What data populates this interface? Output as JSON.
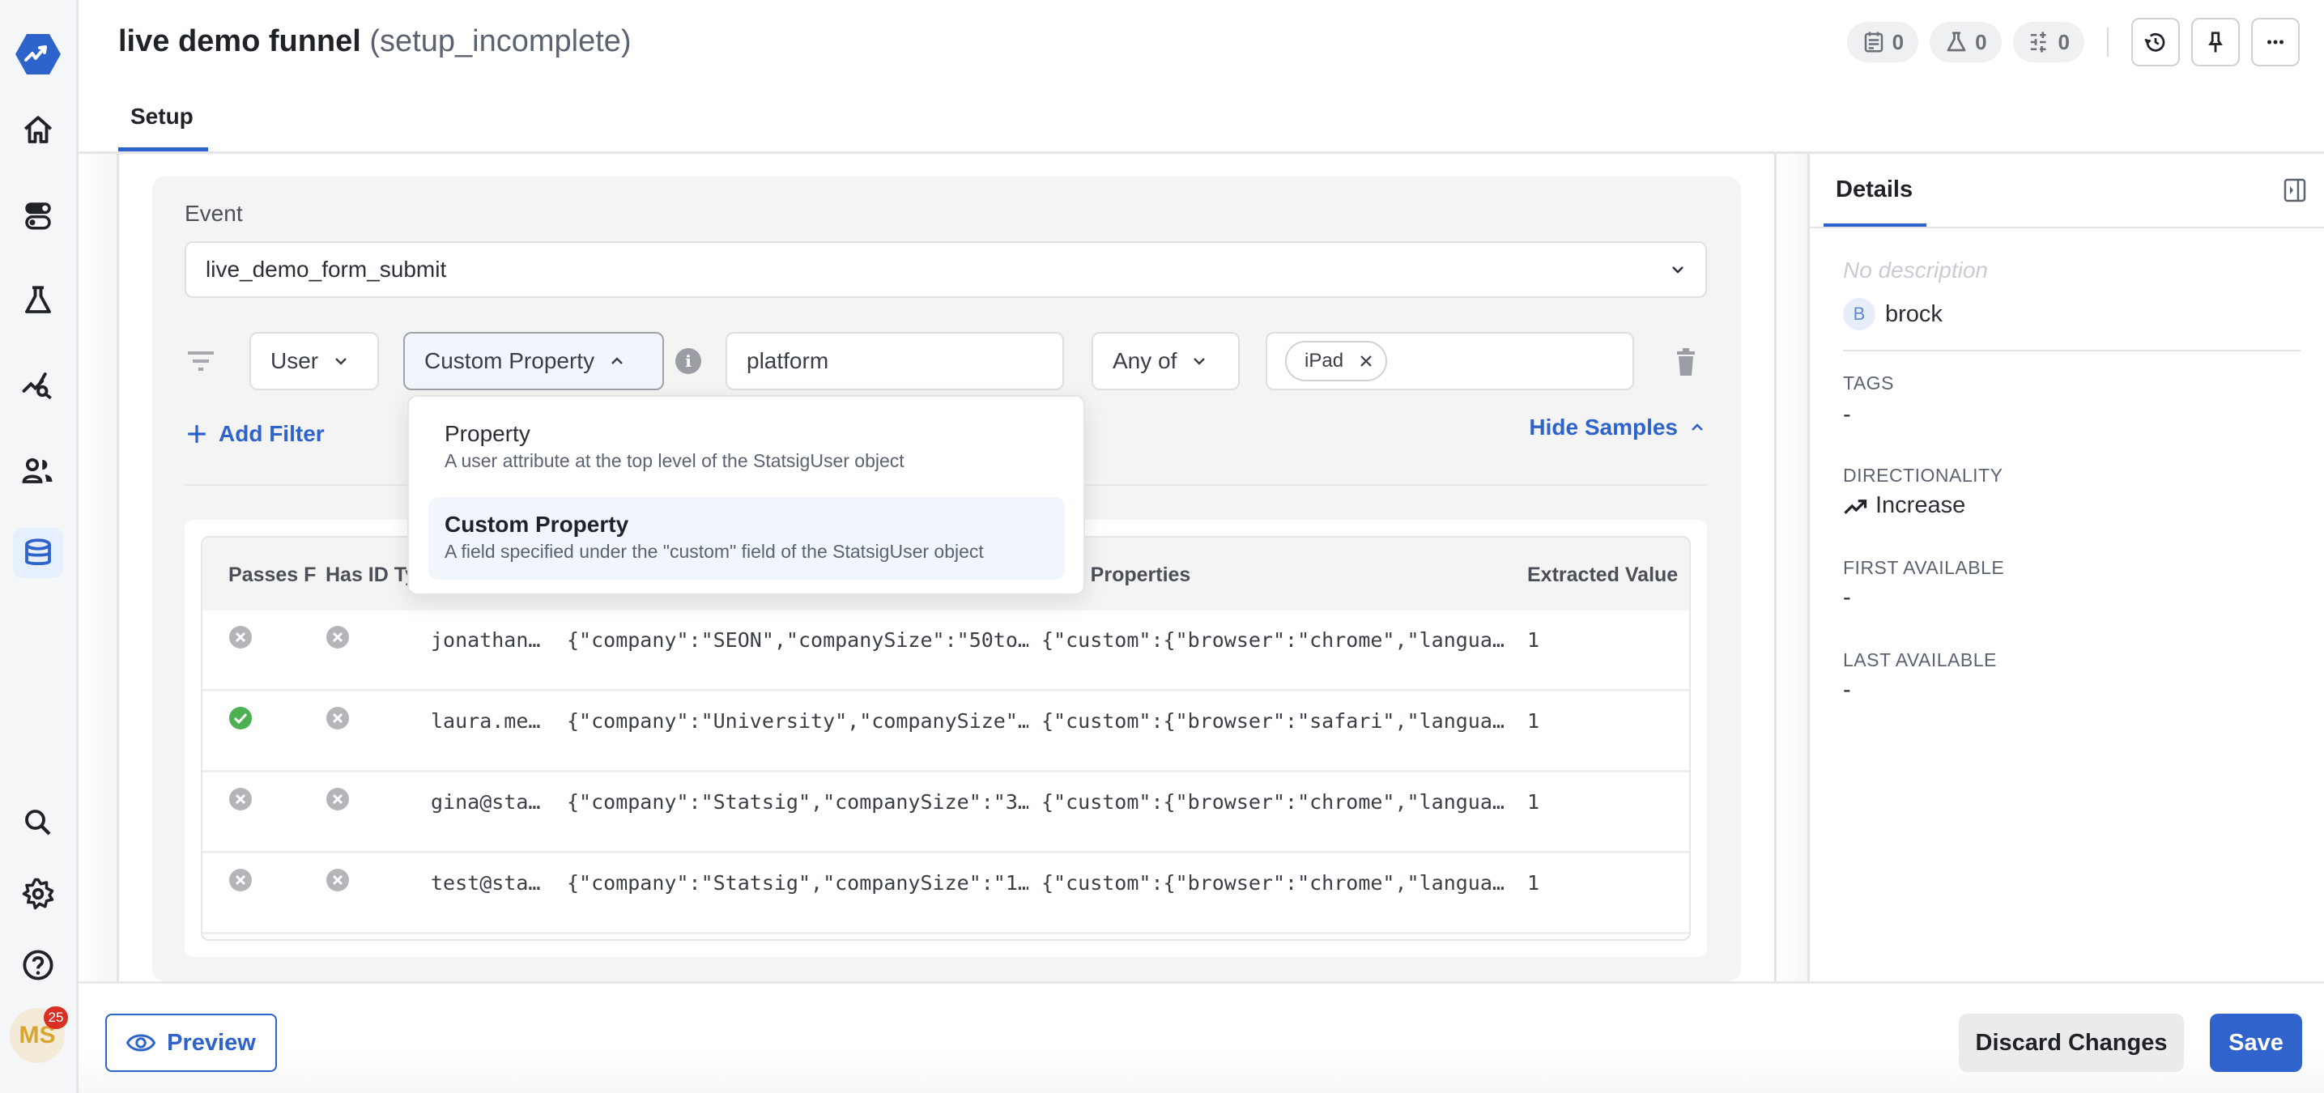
{
  "header": {
    "title": "live demo funnel",
    "status": "(setup_incomplete)",
    "tabs": [
      {
        "label": "Setup",
        "active": true
      }
    ],
    "badges": [
      {
        "icon": "report-icon",
        "count": "0"
      },
      {
        "icon": "experiment-icon",
        "count": "0"
      },
      {
        "icon": "sliders-icon",
        "count": "0"
      }
    ],
    "actions": [
      "history-icon",
      "pin-icon",
      "more-icon"
    ]
  },
  "sidebar": {
    "items": [
      {
        "icon": "home-icon",
        "label": "Home"
      },
      {
        "icon": "toggle-icon",
        "label": "Feature Gates"
      },
      {
        "icon": "flask-icon",
        "label": "Experiments"
      },
      {
        "icon": "analytics-icon",
        "label": "Analytics"
      },
      {
        "icon": "users-icon",
        "label": "Users"
      },
      {
        "icon": "database-icon",
        "label": "Data",
        "active": true
      }
    ],
    "bottom_items": [
      {
        "icon": "search-icon",
        "label": "Search"
      },
      {
        "icon": "gear-icon",
        "label": "Settings"
      },
      {
        "icon": "help-icon",
        "label": "Help"
      }
    ],
    "avatar": {
      "initials": "MS",
      "notifications": "25"
    },
    "accent": "#2f63cc"
  },
  "setup": {
    "event_label": "Event",
    "event_value": "live_demo_form_submit",
    "filter": {
      "scope": "User",
      "property_type": "Custom Property",
      "property_name": "platform",
      "operator": "Any of",
      "values": [
        "iPad"
      ]
    },
    "add_filter_label": "Add Filter",
    "hide_samples_label": "Hide Samples",
    "dropdown": {
      "options": [
        {
          "title": "Property",
          "description": "A user attribute at the top level of the StatsigUser object",
          "selected": false
        },
        {
          "title": "Custom Property",
          "description": "A field specified under the \"custom\" field of the StatsigUser object",
          "selected": true
        }
      ]
    },
    "samples": {
      "columns": [
        "Passes F",
        "Has ID Ty",
        "",
        "",
        "r Properties",
        "Extracted Value"
      ],
      "rows": [
        {
          "passes": false,
          "has_id": false,
          "user": "jonathan…",
          "props": "{\"company\":\"SEON\",\"companySize\":\"50to…",
          "custom": "{\"custom\":{\"browser\":\"chrome\",\"langua…",
          "value": "1"
        },
        {
          "passes": true,
          "has_id": false,
          "user": "laura.me…",
          "props": "{\"company\":\"University\",\"companySize\"…",
          "custom": "{\"custom\":{\"browser\":\"safari\",\"langua…",
          "value": "1"
        },
        {
          "passes": false,
          "has_id": false,
          "user": "gina@sta…",
          "props": "{\"company\":\"Statsig\",\"companySize\":\"3…",
          "custom": "{\"custom\":{\"browser\":\"chrome\",\"langua…",
          "value": "1"
        },
        {
          "passes": false,
          "has_id": false,
          "user": "test@sta…",
          "props": "{\"company\":\"Statsig\",\"companySize\":\"1…",
          "custom": "{\"custom\":{\"browser\":\"chrome\",\"langua…",
          "value": "1"
        }
      ]
    }
  },
  "details": {
    "tab_label": "Details",
    "description_placeholder": "No description",
    "owner": {
      "initial": "B",
      "name": "brock"
    },
    "fields": [
      {
        "label": "TAGS",
        "value": "-"
      },
      {
        "label": "DIRECTIONALITY",
        "value": "Increase",
        "icon": "trend-up-icon"
      },
      {
        "label": "FIRST AVAILABLE",
        "value": "-"
      },
      {
        "label": "LAST AVAILABLE",
        "value": "-"
      }
    ]
  },
  "footer": {
    "preview_label": "Preview",
    "discard_label": "Discard Changes",
    "save_label": "Save"
  },
  "colors": {
    "accent": "#2f63cc",
    "success": "#4caf50",
    "neutral_icon": "#b3b5b8"
  }
}
